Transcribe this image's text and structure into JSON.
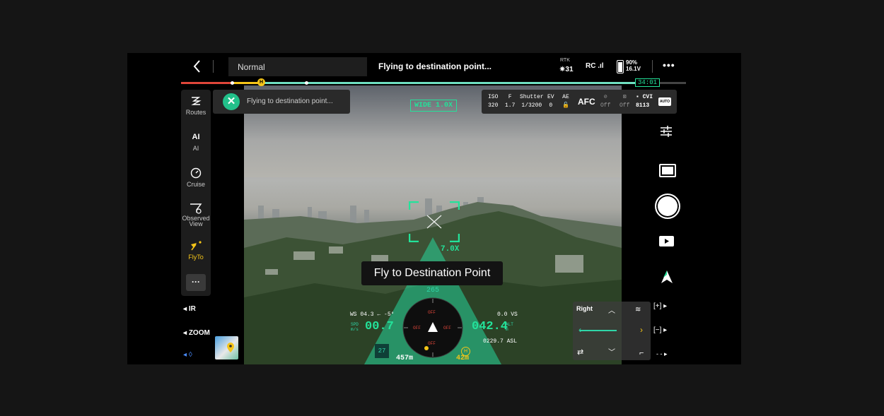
{
  "top_bar": {
    "mode": "Normal",
    "status": "Flying to destination point...",
    "rtk_label": "RTK",
    "rtk_sats": "31",
    "rc_label": "RC",
    "battery_percent": "90%",
    "battery_voltage": "16.1V",
    "flight_time": "34:01"
  },
  "sidebar": {
    "items": [
      {
        "label": "Routes",
        "icon": "routes-icon"
      },
      {
        "label": "AI",
        "icon": "ai-icon",
        "glyph": "AI"
      },
      {
        "label": "Cruise",
        "icon": "cruise-icon"
      },
      {
        "label": "Observed View",
        "icon": "observed-view-icon"
      },
      {
        "label": "FlyTo",
        "icon": "flyto-icon",
        "active": true
      }
    ],
    "more_label": "···",
    "ir_label": "IR",
    "zoom_label": "ZOOM",
    "bottom_glyph": "◊"
  },
  "notification": {
    "text": "Flying to destination point..."
  },
  "camera": {
    "lens_badge": "WIDE 1.0X",
    "iso_label": "ISO",
    "iso_value": "320",
    "f_label": "F",
    "f_value": "1.7",
    "shutter_label": "Shutter",
    "shutter_value": "1/3200",
    "ev_label": "EV",
    "ev_value": "0",
    "ae_label": "AE",
    "focus_mode": "AFC",
    "wb_label": "Off",
    "other_label": "Off",
    "cvi_label": "CVI",
    "cvi_value": "8113",
    "auto_label": "AUTO",
    "zoom_indicator": "7.0X",
    "tooltip": "Fly to Destination Point"
  },
  "hud": {
    "heading": "265",
    "wind": "WS 04.3",
    "wind_dir": "-5°",
    "spd_label": "SPD",
    "spd_unit": "m/s",
    "speed": "00.7",
    "vs": "0.0 VS",
    "altitude": "042.4",
    "alt_label": "ALT",
    "alt_unit": "m",
    "asl": "0229.7 ASL",
    "distance": "457m",
    "home_distance": "42m",
    "badge": "27",
    "off_labels": [
      "OFF",
      "OFF",
      "OFF",
      "OFF"
    ],
    "home_marker": "H"
  },
  "mini_panel": {
    "label": "Right"
  },
  "zoom_buttons": {
    "plus": "[+]",
    "minus": "[−]",
    "more": "- -"
  },
  "colors": {
    "accent": "#23e39a",
    "flyto": "#f5c518",
    "warning": "#e0463a"
  }
}
